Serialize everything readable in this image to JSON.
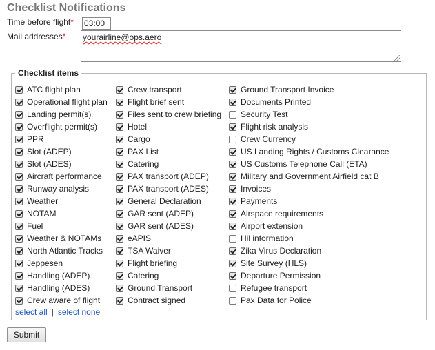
{
  "page": {
    "title": "Checklist Notifications"
  },
  "form": {
    "time_label": "Time before flight",
    "time_value": "03:00",
    "mail_label": "Mail addresses",
    "mail_value": "yourairline@ops.aero",
    "required_mark": "*"
  },
  "checklist": {
    "legend": "Checklist items",
    "columns": [
      [
        {
          "label": "ATC flight plan",
          "checked": true
        },
        {
          "label": "Operational flight plan",
          "checked": true
        },
        {
          "label": "Landing permit(s)",
          "checked": true
        },
        {
          "label": "Overflight permit(s)",
          "checked": true
        },
        {
          "label": "PPR",
          "checked": true
        },
        {
          "label": "Slot (ADEP)",
          "checked": true
        },
        {
          "label": "Slot (ADES)",
          "checked": true
        },
        {
          "label": "Aircraft performance",
          "checked": true
        },
        {
          "label": "Runway analysis",
          "checked": true
        },
        {
          "label": "Weather",
          "checked": true
        },
        {
          "label": "NOTAM",
          "checked": true
        },
        {
          "label": "Fuel",
          "checked": true
        },
        {
          "label": "Weather & NOTAMs",
          "checked": true
        },
        {
          "label": "North Atlantic Tracks",
          "checked": true
        },
        {
          "label": "Jeppesen",
          "checked": true
        },
        {
          "label": "Handling (ADEP)",
          "checked": true
        },
        {
          "label": "Handling (ADES)",
          "checked": true
        },
        {
          "label": "Crew aware of flight",
          "checked": true
        }
      ],
      [
        {
          "label": "Crew transport",
          "checked": true
        },
        {
          "label": "Flight brief sent",
          "checked": true
        },
        {
          "label": "Files sent to crew briefing",
          "checked": true
        },
        {
          "label": "Hotel",
          "checked": true
        },
        {
          "label": "Cargo",
          "checked": true
        },
        {
          "label": "PAX List",
          "checked": true
        },
        {
          "label": "Catering",
          "checked": true
        },
        {
          "label": "PAX transport (ADEP)",
          "checked": true
        },
        {
          "label": "PAX transport (ADES)",
          "checked": true
        },
        {
          "label": "General Declaration",
          "checked": true
        },
        {
          "label": "GAR sent (ADEP)",
          "checked": true
        },
        {
          "label": "GAR sent (ADES)",
          "checked": true
        },
        {
          "label": "eAPIS",
          "checked": true
        },
        {
          "label": "TSA Waiver",
          "checked": true
        },
        {
          "label": "Flight briefing",
          "checked": true
        },
        {
          "label": "Catering",
          "checked": true
        },
        {
          "label": "Ground Transport",
          "checked": true
        },
        {
          "label": "Contract signed",
          "checked": true
        }
      ],
      [
        {
          "label": "Ground Transport Invoice",
          "checked": true
        },
        {
          "label": "Documents Printed",
          "checked": true
        },
        {
          "label": "Security Test",
          "checked": false
        },
        {
          "label": "Flight risk analysis",
          "checked": true
        },
        {
          "label": "Crew Currency",
          "checked": false
        },
        {
          "label": "US Landing Rights / Customs Clearance",
          "checked": true
        },
        {
          "label": "US Customs Telephone Call (ETA)",
          "checked": true
        },
        {
          "label": "Military and Government Airfield cat B",
          "checked": true
        },
        {
          "label": "Invoices",
          "checked": true
        },
        {
          "label": "Payments",
          "checked": true
        },
        {
          "label": "Airspace requirements",
          "checked": true
        },
        {
          "label": "Airport extension",
          "checked": true
        },
        {
          "label": "Hil information",
          "checked": false
        },
        {
          "label": "Zika Virus Declaration",
          "checked": true
        },
        {
          "label": "Site Survey (HLS)",
          "checked": true
        },
        {
          "label": "Departure Permission",
          "checked": true
        },
        {
          "label": "Refugee transport",
          "checked": false
        },
        {
          "label": "Pax Data for Police",
          "checked": false
        }
      ]
    ],
    "select_all": "select all",
    "separator": "|",
    "select_none": "select none"
  },
  "actions": {
    "submit": "Submit"
  }
}
